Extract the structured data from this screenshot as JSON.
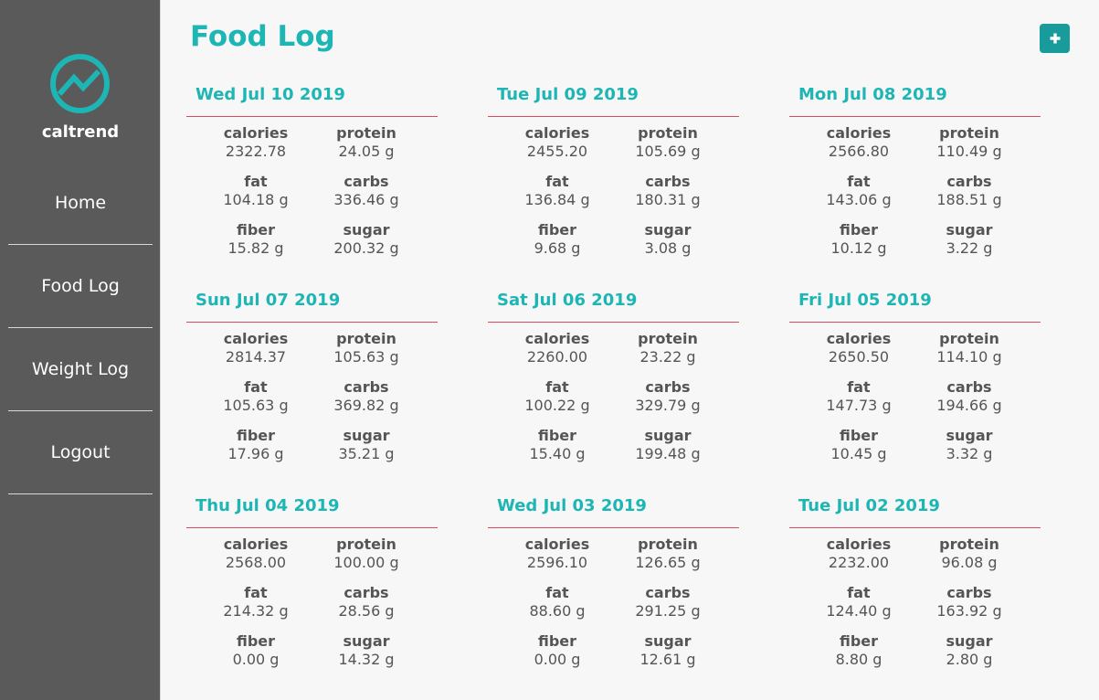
{
  "app": {
    "name": "caltrend"
  },
  "sidebar": {
    "items": [
      {
        "label": "Home"
      },
      {
        "label": "Food Log"
      },
      {
        "label": "Weight Log"
      },
      {
        "label": "Logout"
      }
    ]
  },
  "page": {
    "title": "Food Log"
  },
  "add_button": {
    "icon": "plus-icon"
  },
  "labels": {
    "calories": "calories",
    "protein": "protein",
    "fat": "fat",
    "carbs": "carbs",
    "fiber": "fiber",
    "sugar": "sugar"
  },
  "days": [
    {
      "date": "Wed Jul 10 2019",
      "calories": "2322.78",
      "protein": "24.05 g",
      "fat": "104.18 g",
      "carbs": "336.46 g",
      "fiber": "15.82 g",
      "sugar": "200.32 g"
    },
    {
      "date": "Tue Jul 09 2019",
      "calories": "2455.20",
      "protein": "105.69 g",
      "fat": "136.84 g",
      "carbs": "180.31 g",
      "fiber": "9.68 g",
      "sugar": "3.08 g"
    },
    {
      "date": "Mon Jul 08 2019",
      "calories": "2566.80",
      "protein": "110.49 g",
      "fat": "143.06 g",
      "carbs": "188.51 g",
      "fiber": "10.12 g",
      "sugar": "3.22 g"
    },
    {
      "date": "Sun Jul 07 2019",
      "calories": "2814.37",
      "protein": "105.63 g",
      "fat": "105.63 g",
      "carbs": "369.82 g",
      "fiber": "17.96 g",
      "sugar": "35.21 g"
    },
    {
      "date": "Sat Jul 06 2019",
      "calories": "2260.00",
      "protein": "23.22 g",
      "fat": "100.22 g",
      "carbs": "329.79 g",
      "fiber": "15.40 g",
      "sugar": "199.48 g"
    },
    {
      "date": "Fri Jul 05 2019",
      "calories": "2650.50",
      "protein": "114.10 g",
      "fat": "147.73 g",
      "carbs": "194.66 g",
      "fiber": "10.45 g",
      "sugar": "3.32 g"
    },
    {
      "date": "Thu Jul 04 2019",
      "calories": "2568.00",
      "protein": "100.00 g",
      "fat": "214.32 g",
      "carbs": "28.56 g",
      "fiber": "0.00 g",
      "sugar": "14.32 g"
    },
    {
      "date": "Wed Jul 03 2019",
      "calories": "2596.10",
      "protein": "126.65 g",
      "fat": "88.60 g",
      "carbs": "291.25 g",
      "fiber": "0.00 g",
      "sugar": "12.61 g"
    },
    {
      "date": "Tue Jul 02 2019",
      "calories": "2232.00",
      "protein": "96.08 g",
      "fat": "124.40 g",
      "carbs": "163.92 g",
      "fiber": "8.80 g",
      "sugar": "2.80 g"
    }
  ],
  "colors": {
    "accent": "#1eb5b5",
    "sidebar": "#5a5a5a",
    "rule": "#d94a5a",
    "button": "#199b9b"
  }
}
